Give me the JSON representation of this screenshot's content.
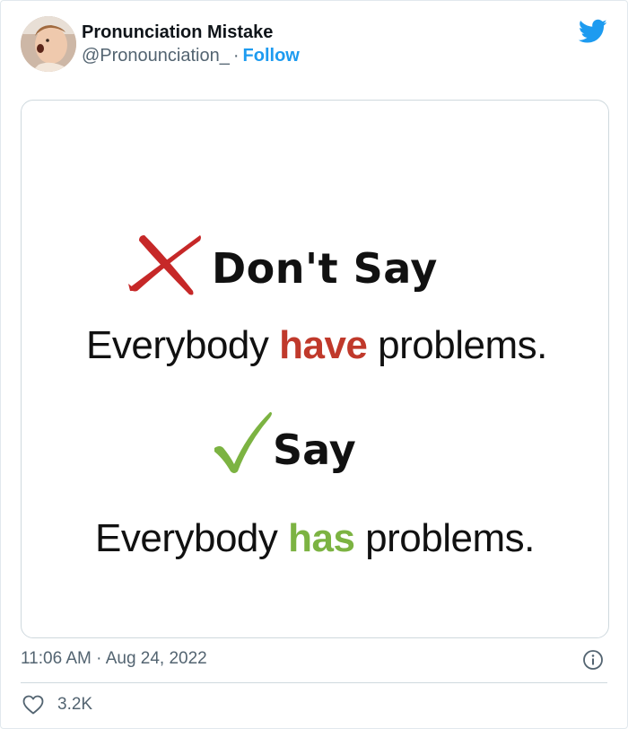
{
  "tweet": {
    "author_name": "Pronunciation Mistake",
    "handle": "@Pronounciation_",
    "separator": "·",
    "follow_label": "Follow",
    "timestamp": "11:06 AM · Aug 24, 2022",
    "like_count": "3.2K"
  },
  "image": {
    "dont_label": "Don't Say",
    "say_label": "Say",
    "wrong_sentence": {
      "before": "Everybody ",
      "highlight": "have",
      "after": " problems."
    },
    "right_sentence": {
      "before": "Everybody ",
      "highlight": "has",
      "after": " problems."
    }
  },
  "icons": {
    "brand": "twitter-bird-icon",
    "wrong": "red-x-icon",
    "right": "green-check-icon",
    "info": "info-icon",
    "like": "heart-icon"
  },
  "colors": {
    "twitter_blue": "#1d9bf0",
    "wrong_red": "#c0392b",
    "right_green": "#7cb342",
    "meta_gray": "#536471"
  }
}
